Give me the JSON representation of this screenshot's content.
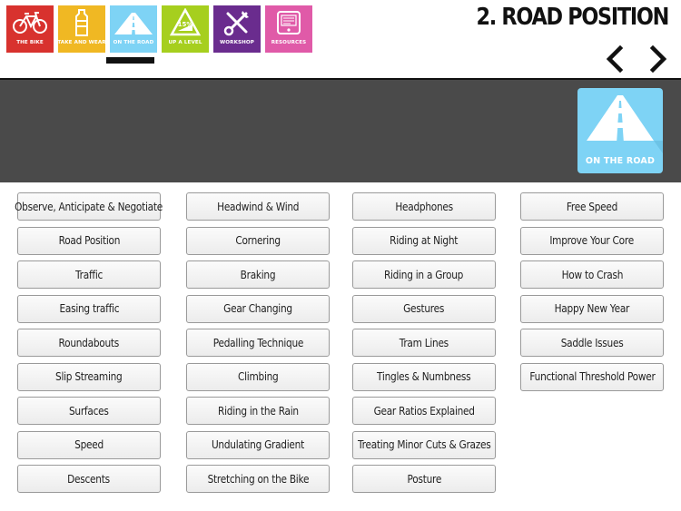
{
  "nav": {
    "tiles": [
      {
        "label": "THE BIKE",
        "color": "#d8322e",
        "icon": "bicycle-icon"
      },
      {
        "label": "TAKE AND WEAR",
        "color": "#f0b823",
        "icon": "water-bottle-icon"
      },
      {
        "label": "ON THE ROAD",
        "color": "#7ed3f5",
        "icon": "road-icon"
      },
      {
        "label": "UP A LEVEL",
        "color": "#a6cf1e",
        "icon": "gradient-sign-icon"
      },
      {
        "label": "WORKSHOP",
        "color": "#6a2c8e",
        "icon": "tools-icon"
      },
      {
        "label": "RESOURCES",
        "color": "#e05aa8",
        "icon": "device-icon"
      }
    ],
    "active_index": 2
  },
  "header": {
    "title": "2. ROAD POSITION"
  },
  "banner": {
    "badge_label": "ON THE ROAD",
    "badge_color": "#7ed3f5",
    "background": "#4a4a4a"
  },
  "topics": {
    "col1": [
      "Observe, Anticipate & Negotiate",
      "Road Position",
      "Traffic",
      "Easing traffic",
      "Roundabouts",
      "Slip Streaming",
      "Surfaces",
      "Speed",
      "Descents"
    ],
    "col2": [
      "Headwind & Wind",
      "Cornering",
      "Braking",
      "Gear Changing",
      "Pedalling Technique",
      "Climbing",
      "Riding in the Rain",
      "Undulating Gradient",
      "Stretching on the Bike"
    ],
    "col3": [
      "Headphones",
      "Riding at Night",
      "Riding in a Group",
      "Gestures",
      "Tram Lines",
      "Tingles & Numbness",
      "Gear Ratios Explained",
      "Treating Minor Cuts & Grazes",
      "Posture"
    ],
    "col4": [
      "Free Speed",
      "Improve Your Core",
      "How to Crash",
      "Happy New Year",
      "Saddle Issues",
      "Functional Threshold Power"
    ]
  }
}
